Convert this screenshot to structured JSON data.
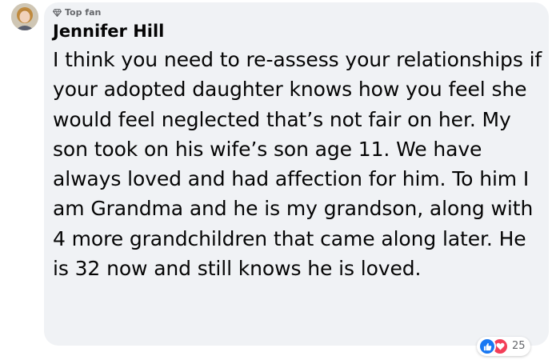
{
  "comment": {
    "badge_label": "Top fan",
    "author": "Jennifer Hill",
    "text": "I think you need to re-assess your relationships if your adopted daughter knows how you feel she would feel neglected that’s not fair on her. My son took on his wife’s son age 11. We have always loved and had affection for him. To him I am Grandma and he is my grandson, along with 4 more grandchildren that came along later. He is 32 now and still knows he is loved.",
    "reactions": {
      "icons": [
        "like-icon",
        "love-icon"
      ],
      "count": "25"
    }
  },
  "colors": {
    "bubble_background": "#f0f2f5",
    "text": "#050505",
    "secondary_text": "#65676b",
    "like_blue": "#1877f2",
    "love_red": "#f33e58"
  }
}
